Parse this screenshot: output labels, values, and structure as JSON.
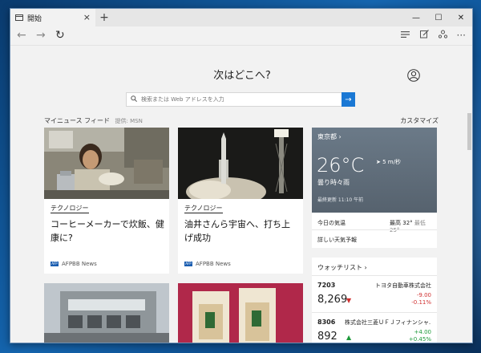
{
  "window": {
    "tab_title": "開始",
    "new_tab": "+",
    "controls": {
      "minimize": "—",
      "maximize": "☐",
      "close": "✕"
    }
  },
  "toolbar": {
    "back": "←",
    "forward": "→",
    "refresh": "↻",
    "more": "···"
  },
  "page": {
    "heading": "次はどこへ?",
    "search_placeholder": "検索または Web アドレスを入力",
    "search_go": "→",
    "section_title": "マイニュース フィード",
    "section_provider": "提供: MSN",
    "customize": "カスタマイズ"
  },
  "news": [
    {
      "category": "テクノロジー",
      "title": "コーヒーメーカーで炊飯、健康に?",
      "source": "AFPBB News"
    },
    {
      "category": "テクノロジー",
      "title": "油井さんら宇宙へ、打ち上げ成功",
      "source": "AFPBB News"
    }
  ],
  "weather": {
    "city": "東京都",
    "temperature": "26°C",
    "wind": "5 m/秒",
    "condition": "曇り時々雨",
    "updated": "最終更新 11:10 午前",
    "today_label": "今日の気温",
    "high_label": "最高",
    "high": "32°",
    "low_label": "最低",
    "low": "25°",
    "details": "詳しい天気予報"
  },
  "watchlist": {
    "title": "ウォッチリスト",
    "stocks": [
      {
        "code": "7203",
        "name": "トヨタ自動車株式会社",
        "price": "8,269",
        "change": "-9.00",
        "percent": "-0.11%",
        "direction": "down"
      },
      {
        "code": "8306",
        "name": "株式会社三菱ＵＦＪフィナンシャ…",
        "price": "892",
        "change": "+4.00",
        "percent": "+0.45%",
        "direction": "up"
      }
    ]
  },
  "colors": {
    "accent": "#1a78d4",
    "down": "#d03030",
    "up": "#1d9a3a"
  }
}
